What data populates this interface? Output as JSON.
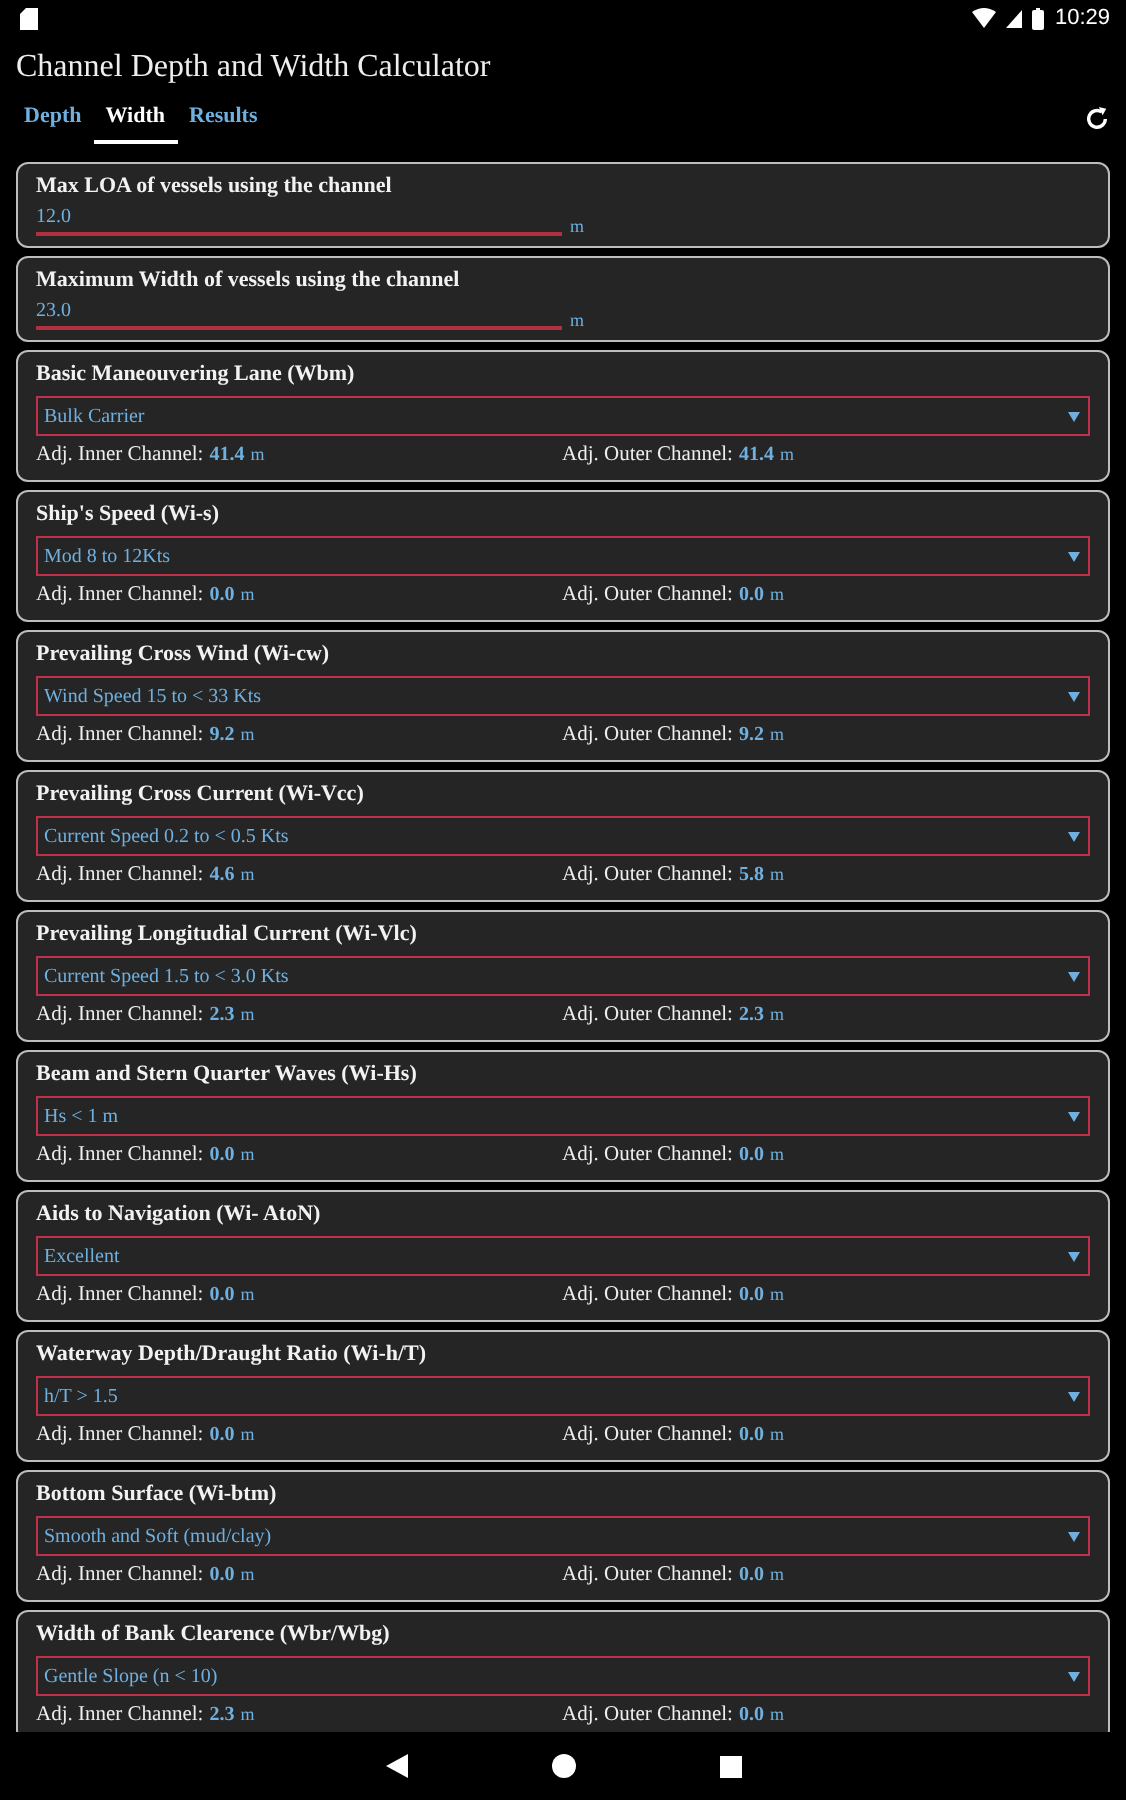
{
  "status_bar": {
    "time": "10:29"
  },
  "app_bar": {
    "title": "Channel Depth and Width Calculator"
  },
  "tabs": [
    {
      "label": "Depth",
      "selected": false
    },
    {
      "label": "Width",
      "selected": true
    },
    {
      "label": "Results",
      "selected": false
    }
  ],
  "cards": [
    {
      "kind": "input",
      "title": "Max LOA of vessels using the channel",
      "value": "12.0",
      "unit": "m"
    },
    {
      "kind": "input",
      "title": "Maximum Width of vessels using the channel",
      "value": "23.0",
      "unit": "m"
    },
    {
      "kind": "select",
      "title": "Basic Maneouvering Lane (Wbm)",
      "value": "Bulk Carrier",
      "inner_label": "Adj. Inner Channel:",
      "inner": "41.4",
      "inner_unit": "m",
      "outer_label": "Adj. Outer Channel:",
      "outer": "41.4",
      "outer_unit": "m"
    },
    {
      "kind": "select",
      "title": "Ship's Speed (Wi-s)",
      "value": "Mod 8 to 12Kts",
      "inner_label": "Adj. Inner Channel:",
      "inner": "0.0",
      "inner_unit": "m",
      "outer_label": "Adj. Outer Channel:",
      "outer": "0.0",
      "outer_unit": "m"
    },
    {
      "kind": "select",
      "title": "Prevailing Cross Wind (Wi-cw)",
      "value": "Wind Speed 15 to < 33 Kts",
      "inner_label": "Adj. Inner Channel:",
      "inner": "9.2",
      "inner_unit": "m",
      "outer_label": "Adj. Outer Channel:",
      "outer": "9.2",
      "outer_unit": "m"
    },
    {
      "kind": "select",
      "title": "Prevailing Cross Current (Wi-Vcc)",
      "value": "Current Speed 0.2 to < 0.5 Kts",
      "inner_label": "Adj. Inner Channel:",
      "inner": "4.6",
      "inner_unit": "m",
      "outer_label": "Adj. Outer Channel:",
      "outer": "5.8",
      "outer_unit": "m"
    },
    {
      "kind": "select",
      "title": "Prevailing Longitudial Current (Wi-Vlc)",
      "value": "Current Speed 1.5 to < 3.0 Kts",
      "inner_label": "Adj. Inner Channel:",
      "inner": "2.3",
      "inner_unit": "m",
      "outer_label": "Adj. Outer Channel:",
      "outer": "2.3",
      "outer_unit": "m"
    },
    {
      "kind": "select",
      "title": "Beam and Stern Quarter Waves (Wi-Hs)",
      "value": "Hs < 1 m",
      "inner_label": "Adj. Inner Channel:",
      "inner": "0.0",
      "inner_unit": "m",
      "outer_label": "Adj. Outer Channel:",
      "outer": "0.0",
      "outer_unit": "m"
    },
    {
      "kind": "select",
      "title": "Aids to Navigation (Wi- AtoN)",
      "value": "Excellent",
      "inner_label": "Adj. Inner Channel:",
      "inner": "0.0",
      "inner_unit": "m",
      "outer_label": "Adj. Outer Channel:",
      "outer": "0.0",
      "outer_unit": "m"
    },
    {
      "kind": "select",
      "title": "Waterway Depth/Draught Ratio (Wi-h/T)",
      "value": "h/T > 1.5",
      "inner_label": "Adj. Inner Channel:",
      "inner": "0.0",
      "inner_unit": "m",
      "outer_label": "Adj. Outer Channel:",
      "outer": "0.0",
      "outer_unit": "m"
    },
    {
      "kind": "select",
      "title": "Bottom Surface (Wi-btm)",
      "value": "Smooth and Soft (mud/clay)",
      "inner_label": "Adj. Inner Channel:",
      "inner": "0.0",
      "inner_unit": "m",
      "outer_label": "Adj. Outer Channel:",
      "outer": "0.0",
      "outer_unit": "m"
    },
    {
      "kind": "select",
      "title": "Width of Bank Clearence (Wbr/Wbg)",
      "value": "Gentle Slope (n < 10)",
      "inner_label": "Adj. Inner Channel:",
      "inner": "2.3",
      "inner_unit": "m",
      "outer_label": "Adj. Outer Channel:",
      "outer": "0.0",
      "outer_unit": "m"
    }
  ]
}
